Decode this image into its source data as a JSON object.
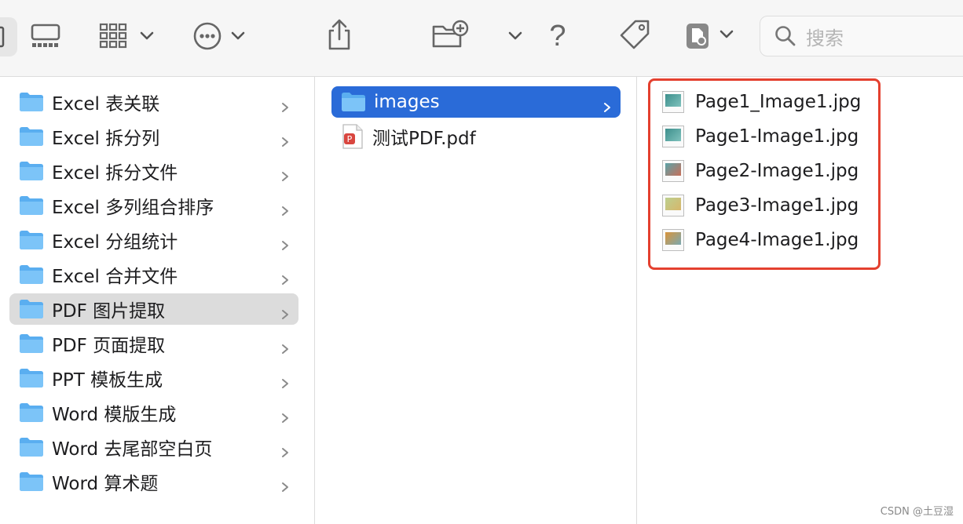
{
  "toolbar": {
    "icons": [
      "sidebar-icon",
      "gallery-view-icon",
      "group-view-icon",
      "more-actions-icon",
      "share-icon",
      "new-folder-icon",
      "help-icon",
      "tag-icon",
      "document-icon"
    ],
    "help_label": "?",
    "search": {
      "placeholder": "搜索"
    }
  },
  "columns": {
    "first": [
      {
        "label": "Excel 表关联"
      },
      {
        "label": "Excel 拆分列"
      },
      {
        "label": "Excel 拆分文件"
      },
      {
        "label": "Excel 多列组合排序"
      },
      {
        "label": "Excel 分组统计"
      },
      {
        "label": "Excel 合并文件"
      },
      {
        "label": "PDF 图片提取"
      },
      {
        "label": "PDF 页面提取"
      },
      {
        "label": "PPT 模板生成"
      },
      {
        "label": "Word 模版生成"
      },
      {
        "label": "Word 去尾部空白页"
      },
      {
        "label": "Word 算术题"
      }
    ],
    "second": [
      {
        "label": "images"
      },
      {
        "label": "测试PDF.pdf"
      }
    ],
    "third": [
      {
        "label": "Page1_Image1.jpg"
      },
      {
        "label": "Page1-Image1.jpg"
      },
      {
        "label": "Page2-Image1.jpg"
      },
      {
        "label": "Page3-Image1.jpg"
      },
      {
        "label": "Page4-Image1.jpg"
      }
    ]
  },
  "colors": {
    "selection_blue": "#2a6bd8",
    "selection_gray": "#dcdcdc",
    "highlight_red": "#e4402f",
    "folder_blue": "#5aaef0"
  },
  "watermark": "CSDN @土豆湿"
}
